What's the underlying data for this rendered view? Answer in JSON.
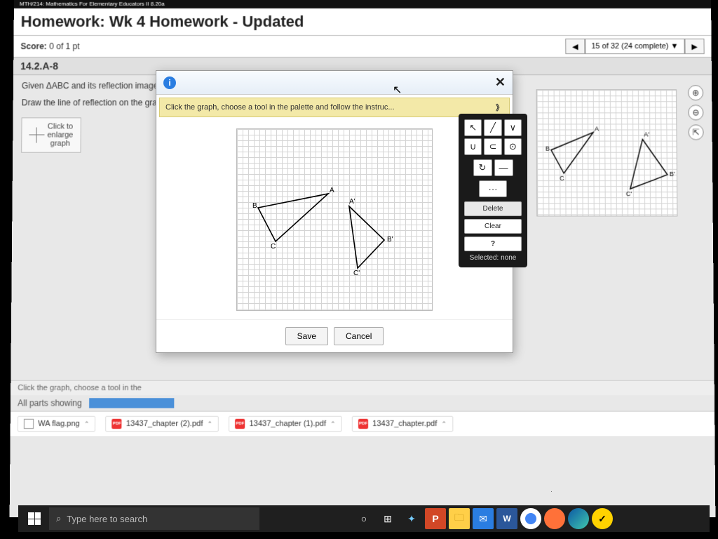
{
  "course_header": "MTH/214: Mathematics For Elementary Educators II 8.20a",
  "title": "Homework: Wk 4 Homework - Updated",
  "score_label": "Score:",
  "score_value": "0 of 1 pt",
  "nav_position": "15 of 32 (24 complete)",
  "question_id": "14.2.A-8",
  "problem_line1": "Given ΔABC and its reflection image ΔA′B′C′",
  "problem_line2": "Draw the line of reflection on the graph.",
  "enlarge_text": "Click to\nenlarge\ngraph",
  "footer_hint": "Click the graph, choose a tool in the",
  "all_parts": "All parts showing",
  "modal": {
    "hint": "Click the graph, choose a tool in the palette and follow the instruc...",
    "save": "Save",
    "cancel": "Cancel"
  },
  "palette": {
    "tools": [
      "↖",
      "╱",
      "∨",
      "∪",
      "⊂",
      "⊙"
    ],
    "move": "↻",
    "line": "—",
    "dots": "···",
    "delete": "Delete",
    "clear": "Clear",
    "help": "?",
    "selected": "Selected: none"
  },
  "right_tools": [
    "⊕",
    "⊖",
    "⇱"
  ],
  "downloads": [
    {
      "icon": "img",
      "name": "WA flag.png"
    },
    {
      "icon": "pdf",
      "name": "13437_chapter (2).pdf"
    },
    {
      "icon": "pdf",
      "name": "13437_chapter (1).pdf"
    },
    {
      "icon": "pdf",
      "name": "13437_chapter.pdf"
    }
  ],
  "search_placeholder": "Type here to search",
  "labels": {
    "A": "A",
    "B": "B",
    "C": "C",
    "Ap": "A'",
    "Bp": "B'",
    "Cp": "C'"
  }
}
